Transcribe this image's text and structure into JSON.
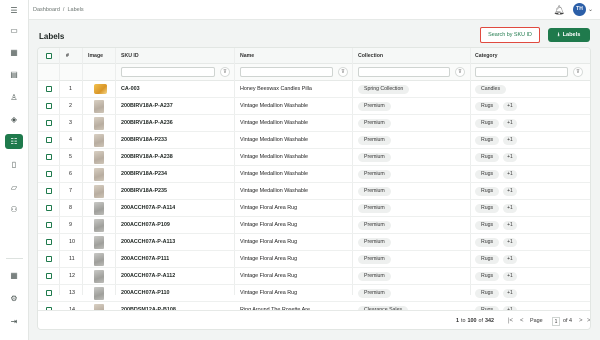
{
  "sidebar": {
    "icons": [
      "menu-icon",
      "dashboard-icon",
      "grid-icon",
      "document-icon",
      "user-icon",
      "tag-icon",
      "sliders-icon",
      "file-icon",
      "folder-icon",
      "hierarchy-icon",
      "apps-icon",
      "settings-icon",
      "logout-icon"
    ]
  },
  "breadcrumb": {
    "root": "Dashboard",
    "sep": "/",
    "current": "Labels"
  },
  "user": {
    "initials": "TH"
  },
  "page": {
    "title": "Labels"
  },
  "buttons": {
    "search_sku": "Search by SKU ID",
    "labels": "Labels",
    "labels_icon": "⭳"
  },
  "table": {
    "headers": {
      "index": "#",
      "image": "Image",
      "sku": "SKU ID",
      "name": "Name",
      "collection": "Collection",
      "category": "Category"
    },
    "rows": [
      {
        "index": "1",
        "image": "candle",
        "sku": "CA-003",
        "name": "Honey Beeswax Candles Pilla",
        "collection": "Spring Collection",
        "category": "Candles",
        "more": ""
      },
      {
        "index": "2",
        "image": "beige",
        "sku": "200BIRV18A-P-A237",
        "name": "Vintage Medallion Washable",
        "collection": "Premium",
        "category": "Rugs",
        "more": "+1"
      },
      {
        "index": "3",
        "image": "beige",
        "sku": "200BIRV18A-P-A236",
        "name": "Vintage Medallion Washable",
        "collection": "Premium",
        "category": "Rugs",
        "more": "+1"
      },
      {
        "index": "4",
        "image": "beige",
        "sku": "200BIRV18A-P233",
        "name": "Vintage Medallion Washable",
        "collection": "Premium",
        "category": "Rugs",
        "more": "+1"
      },
      {
        "index": "5",
        "image": "beige",
        "sku": "200BIRV18A-P-A238",
        "name": "Vintage Medallion Washable",
        "collection": "Premium",
        "category": "Rugs",
        "more": "+1"
      },
      {
        "index": "6",
        "image": "beige",
        "sku": "200BIRV18A-P234",
        "name": "Vintage Medallion Washable",
        "collection": "Premium",
        "category": "Rugs",
        "more": "+1"
      },
      {
        "index": "7",
        "image": "beige",
        "sku": "200BIRV18A-P235",
        "name": "Vintage Medallion Washable",
        "collection": "Premium",
        "category": "Rugs",
        "more": "+1"
      },
      {
        "index": "8",
        "image": "gray",
        "sku": "200ACCH07A-P-A114",
        "name": "Vintage Floral Area Rug",
        "collection": "Premium",
        "category": "Rugs",
        "more": "+1"
      },
      {
        "index": "9",
        "image": "gray",
        "sku": "200ACCH07A-P109",
        "name": "Vintage Floral Area Rug",
        "collection": "Premium",
        "category": "Rugs",
        "more": "+1"
      },
      {
        "index": "10",
        "image": "gray",
        "sku": "200ACCH07A-P-A113",
        "name": "Vintage Floral Area Rug",
        "collection": "Premium",
        "category": "Rugs",
        "more": "+1"
      },
      {
        "index": "11",
        "image": "gray",
        "sku": "200ACCH07A-P111",
        "name": "Vintage Floral Area Rug",
        "collection": "Premium",
        "category": "Rugs",
        "more": "+1"
      },
      {
        "index": "12",
        "image": "gray",
        "sku": "200ACCH07A-P-A112",
        "name": "Vintage Floral Area Rug",
        "collection": "Premium",
        "category": "Rugs",
        "more": "+1"
      },
      {
        "index": "13",
        "image": "gray",
        "sku": "200ACCH07A-P110",
        "name": "Vintage Floral Area Rug",
        "collection": "Premium",
        "category": "Rugs",
        "more": "+1"
      },
      {
        "index": "14",
        "image": "beige",
        "sku": "200BDSM12A-P-B108",
        "name": "Ring Around The Rosette Are",
        "collection": "Clearance Sales",
        "category": "Rugs",
        "more": "+1"
      }
    ]
  },
  "pagination": {
    "range_start": "1",
    "to": "to",
    "range_end": "100",
    "of": "of",
    "total": "342",
    "page_label": "Page",
    "page": "1",
    "page_of": "of 4"
  }
}
